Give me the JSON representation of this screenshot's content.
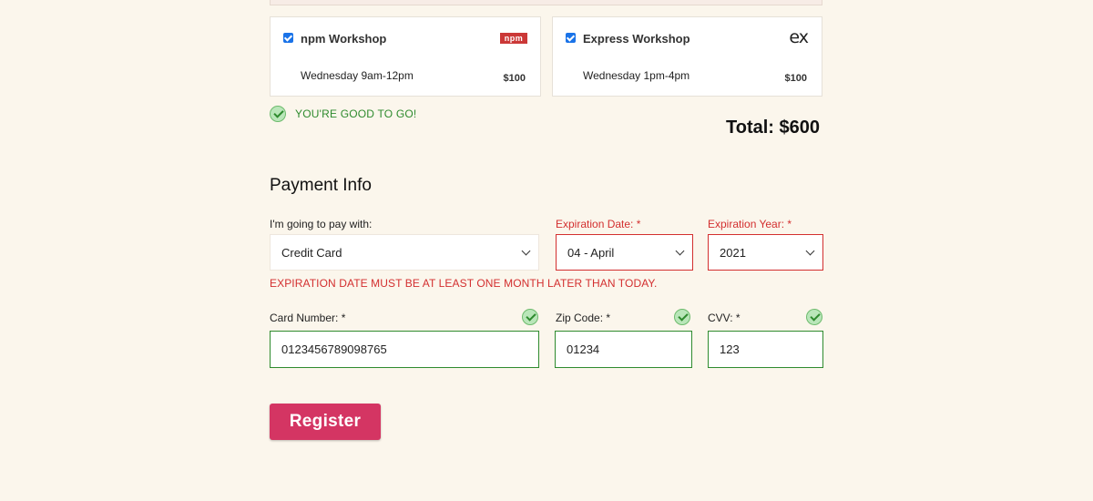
{
  "workshops": [
    {
      "name": "npm Workshop",
      "time": "Wednesday 9am-12pm",
      "price": "$100",
      "checked": true,
      "logo_text": "npm",
      "logo_icon": "npm-logo-icon"
    },
    {
      "name": "Express Workshop",
      "time": "Wednesday 1pm-4pm",
      "price": "$100",
      "checked": true,
      "logo_text": "ex",
      "logo_icon": "express-logo-icon"
    }
  ],
  "status": {
    "ok_text": "YOU'RE GOOD TO GO!",
    "icon": "check-circle-icon"
  },
  "total": "Total: $600",
  "payment": {
    "title": "Payment Info",
    "method_label": "I'm going to pay with:",
    "method_value": "Credit Card",
    "exp_date_label": "Expiration Date: *",
    "exp_date_value": "04 - April",
    "exp_year_label": "Expiration Year: *",
    "exp_year_value": "2021",
    "error_message": "EXPIRATION DATE MUST BE AT LEAST ONE MONTH LATER THAN TODAY.",
    "card_label": "Card Number: *",
    "card_value": "0123456789098765",
    "zip_label": "Zip Code: *",
    "zip_value": "01234",
    "cvv_label": "CVV: *",
    "cvv_value": "123"
  },
  "register_label": "Register",
  "colors": {
    "accent": "#d43563",
    "error": "#d32f2f",
    "success": "#2e8b2e",
    "background": "#fbf6ec"
  }
}
